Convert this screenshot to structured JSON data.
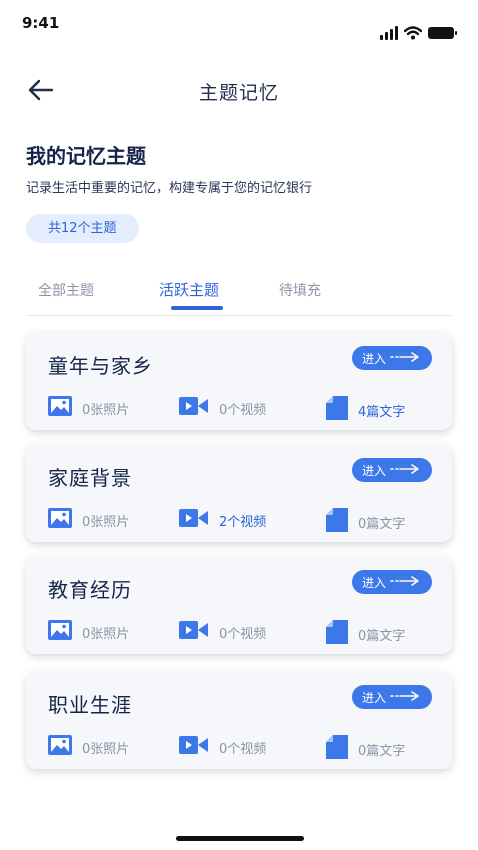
{
  "status_bar": {
    "time": "9:41"
  },
  "header": {
    "title": "主题记忆"
  },
  "intro": {
    "title": "我的记忆主题",
    "subtitle": "记录生活中重要的记忆，构建专属于您的记忆银行",
    "count_badge": "共12个主题"
  },
  "tabs": [
    {
      "label": "全部主题",
      "active": false
    },
    {
      "label": "活跃主题",
      "active": true
    },
    {
      "label": "待填充",
      "active": false
    }
  ],
  "cards": [
    {
      "title": "童年与家乡",
      "enter_label": "进入",
      "photos": "0张照片",
      "videos": "0个视频",
      "texts": "4篇文字",
      "highlight": "texts"
    },
    {
      "title": "家庭背景",
      "enter_label": "进入",
      "photos": "0张照片",
      "videos": "2个视频",
      "texts": "0篇文字",
      "highlight": "videos"
    },
    {
      "title": "教育经历",
      "enter_label": "进入",
      "photos": "0张照片",
      "videos": "0个视频",
      "texts": "0篇文字",
      "highlight": "none"
    },
    {
      "title": "职业生涯",
      "enter_label": "进入",
      "photos": "0张照片",
      "videos": "0个视频",
      "texts": "0篇文字",
      "highlight": "none"
    }
  ],
  "colors": {
    "accent": "#2f63d8",
    "button": "#3d78ea",
    "badge_bg": "#e4edfd",
    "card_bg": "#f5f7fb"
  }
}
